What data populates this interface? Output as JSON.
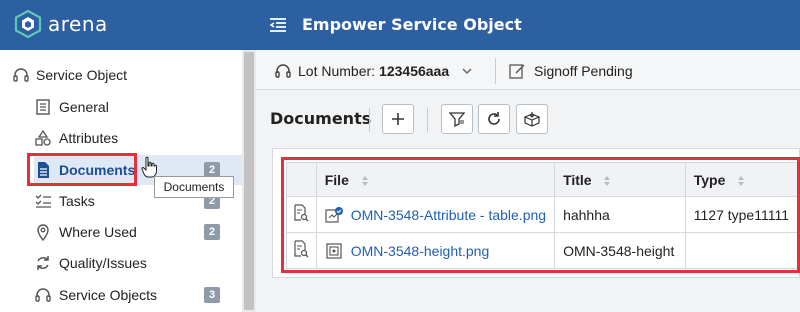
{
  "header": {
    "brand": "arena",
    "page_title": "Empower Service Object"
  },
  "sidebar": {
    "root_label": "Service Object",
    "items": [
      {
        "label": "General",
        "icon": "list-icon"
      },
      {
        "label": "Attributes",
        "icon": "shapes-icon"
      },
      {
        "label": "Documents",
        "icon": "document-icon",
        "badge": "2",
        "active": true
      },
      {
        "label": "Tasks",
        "icon": "tasks-icon",
        "badge": "2"
      },
      {
        "label": "Where Used",
        "icon": "location-pin-icon",
        "badge": "2"
      },
      {
        "label": "Quality/Issues",
        "icon": "cycle-icon"
      },
      {
        "label": "Service Objects",
        "icon": "headset-icon",
        "badge": "3"
      }
    ],
    "tooltip": "Documents"
  },
  "subheader": {
    "lot_label": "Lot Number:",
    "lot_value": "123456aaa",
    "status": "Signoff Pending"
  },
  "documents": {
    "title": "Documents",
    "columns": [
      "File",
      "Title",
      "Type"
    ],
    "rows": [
      {
        "file": "OMN-3548-Attribute - table.png",
        "title": "hahhha",
        "type": "1127 type11111"
      },
      {
        "file": "OMN-3548-height.png",
        "title": "OMN-3548-height",
        "type": ""
      }
    ]
  },
  "colors": {
    "header_bg": "#2d5fa3",
    "accent": "#1f5fb4",
    "highlight": "#e5303a",
    "badge": "#8e9aa8"
  }
}
